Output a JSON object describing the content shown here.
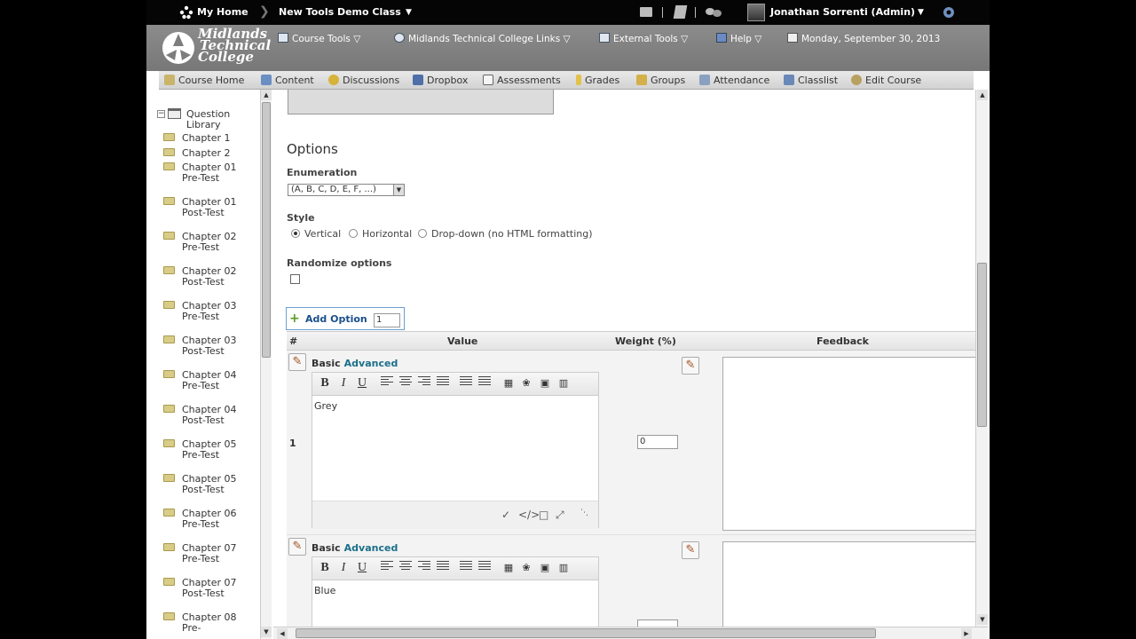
{
  "topbar": {
    "my_home": "My Home",
    "course": "New Tools Demo Class",
    "user": "Jonathan Sorrenti (Admin)",
    "icons": [
      "mail-icon",
      "notifications-icon",
      "chat-icon",
      "settings-icon"
    ]
  },
  "banner": {
    "logo_lines": [
      "Midlands",
      "Technical",
      "College"
    ],
    "links": [
      {
        "label": "Course Tools",
        "icon": "tools-icon",
        "dropdown": true
      },
      {
        "label": "Midlands Technical College Links",
        "icon": "links-icon",
        "dropdown": true
      },
      {
        "label": "External Tools",
        "icon": "external-icon",
        "dropdown": true
      },
      {
        "label": "Help",
        "icon": "help-icon",
        "dropdown": true
      }
    ],
    "date": "Monday, September 30, 2013"
  },
  "course_nav": [
    {
      "label": "Course Home",
      "icon": "home-icon",
      "color": "#c9b46a"
    },
    {
      "label": "Content",
      "icon": "content-icon",
      "color": "#6b8fc2"
    },
    {
      "label": "Discussions",
      "icon": "discussions-icon",
      "color": "#d6b33a"
    },
    {
      "label": "Dropbox",
      "icon": "dropbox-icon",
      "color": "#4f6fa8"
    },
    {
      "label": "Assessments",
      "icon": "assessments-icon",
      "color": "#e8e8e8"
    },
    {
      "label": "Grades",
      "icon": "grades-icon",
      "color": "#e2c24a"
    },
    {
      "label": "Groups",
      "icon": "groups-icon",
      "color": "#d4b04a"
    },
    {
      "label": "Attendance",
      "icon": "attendance-icon",
      "color": "#8aa0c0"
    },
    {
      "label": "Classlist",
      "icon": "classlist-icon",
      "color": "#6a88b8"
    },
    {
      "label": "Edit Course",
      "icon": "edit-course-icon",
      "color": "#b8a060"
    }
  ],
  "tree": {
    "root": "Question Library",
    "chapters": [
      "Chapter 1",
      "Chapter 2",
      "Chapter 01 Pre-Test",
      "Chapter 01 Post-Test",
      "Chapter 02 Pre-Test",
      "Chapter 02 Post-Test",
      "Chapter 03 Pre-Test",
      "Chapter 03 Post-Test",
      "Chapter 04 Pre-Test",
      "Chapter 04 Post-Test",
      "Chapter 05 Pre-Test",
      "Chapter 05 Post-Test",
      "Chapter 06 Pre-Test",
      "Chapter 07 Pre-Test",
      "Chapter 07 Post-Test",
      "Chapter 08 Pre-"
    ]
  },
  "options": {
    "heading": "Options",
    "enumeration_label": "Enumeration",
    "enumeration_value": "(A, B, C, D, E, F, ...)",
    "style_label": "Style",
    "style_options": [
      {
        "label": "Vertical",
        "selected": true
      },
      {
        "label": "Horizontal",
        "selected": false
      },
      {
        "label": "Drop-down (no HTML formatting)",
        "selected": false
      }
    ],
    "randomize_label": "Randomize options",
    "randomize_checked": false,
    "add_option_label": "Add Option",
    "add_option_count": "1"
  },
  "table": {
    "headers": {
      "index": "#",
      "value": "Value",
      "weight": "Weight (%)",
      "feedback": "Feedback"
    },
    "rows": [
      {
        "index": "1",
        "basic": "Basic",
        "advanced": "Advanced",
        "value": "Grey",
        "weight": "0",
        "feedback": ""
      },
      {
        "index": "",
        "basic": "Basic",
        "advanced": "Advanced",
        "value": "Blue",
        "weight": "",
        "feedback": ""
      }
    ]
  }
}
